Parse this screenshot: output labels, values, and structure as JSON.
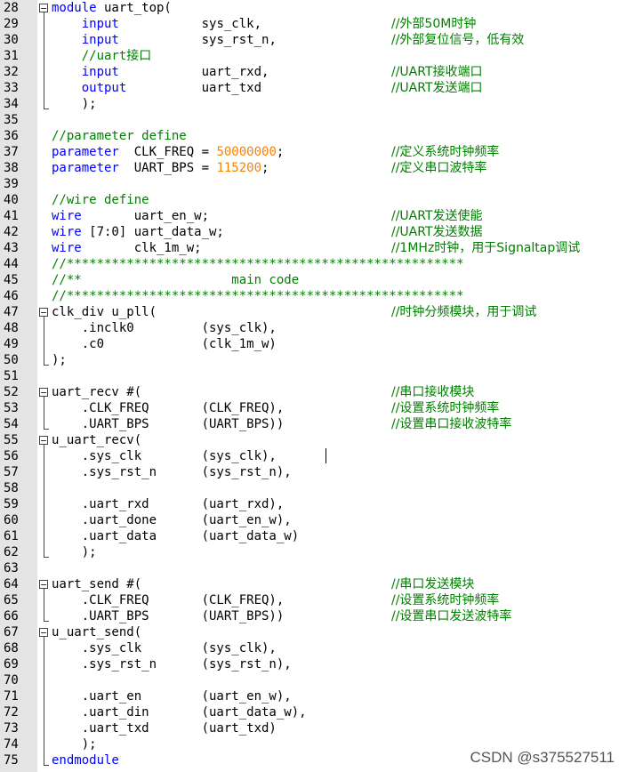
{
  "editor": {
    "lines": [
      {
        "n": "28",
        "parts": [
          {
            "t": "module",
            "c": "kw"
          },
          {
            "t": " uart_top("
          }
        ]
      },
      {
        "n": "29",
        "parts": [
          {
            "t": "    "
          },
          {
            "t": "input",
            "c": "kw"
          },
          {
            "t": "           sys_clk,"
          }
        ],
        "comment": "//外部50M时钟"
      },
      {
        "n": "30",
        "parts": [
          {
            "t": "    "
          },
          {
            "t": "input",
            "c": "kw"
          },
          {
            "t": "           sys_rst_n,"
          }
        ],
        "comment": "//外部复位信号，低有效"
      },
      {
        "n": "31",
        "parts": [
          {
            "t": "    "
          },
          {
            "t": "//uart接口",
            "c": "green"
          }
        ]
      },
      {
        "n": "32",
        "parts": [
          {
            "t": "    "
          },
          {
            "t": "input",
            "c": "kw"
          },
          {
            "t": "           uart_rxd,"
          }
        ],
        "comment": "//UART接收端口"
      },
      {
        "n": "33",
        "parts": [
          {
            "t": "    "
          },
          {
            "t": "output",
            "c": "kw"
          },
          {
            "t": "          uart_txd"
          }
        ],
        "comment": "//UART发送端口"
      },
      {
        "n": "34",
        "parts": [
          {
            "t": "    );"
          }
        ]
      },
      {
        "n": "35",
        "parts": []
      },
      {
        "n": "36",
        "parts": [
          {
            "t": "//parameter define",
            "c": "green"
          }
        ]
      },
      {
        "n": "37",
        "parts": [
          {
            "t": "parameter",
            "c": "kw"
          },
          {
            "t": "  CLK_FREQ = "
          },
          {
            "t": "50000000",
            "c": "num"
          },
          {
            "t": ";"
          }
        ],
        "comment": "//定义系统时钟频率"
      },
      {
        "n": "38",
        "parts": [
          {
            "t": "parameter",
            "c": "kw"
          },
          {
            "t": "  UART_BPS = "
          },
          {
            "t": "115200",
            "c": "num"
          },
          {
            "t": ";"
          }
        ],
        "comment": "//定义串口波特率"
      },
      {
        "n": "39",
        "parts": []
      },
      {
        "n": "40",
        "parts": [
          {
            "t": "//wire define",
            "c": "green"
          }
        ]
      },
      {
        "n": "41",
        "parts": [
          {
            "t": "wire",
            "c": "kw"
          },
          {
            "t": "       uart_en_w;"
          }
        ],
        "comment": "//UART发送使能"
      },
      {
        "n": "42",
        "parts": [
          {
            "t": "wire",
            "c": "kw"
          },
          {
            "t": " [7:0] uart_data_w;"
          }
        ],
        "comment": "//UART发送数据"
      },
      {
        "n": "43",
        "parts": [
          {
            "t": "wire",
            "c": "kw"
          },
          {
            "t": "       clk_1m_w;"
          }
        ],
        "comment": "//1MHz时钟，用于Signaltap调试"
      },
      {
        "n": "44",
        "parts": [
          {
            "t": "//*****************************************************",
            "c": "green"
          }
        ]
      },
      {
        "n": "45",
        "parts": [
          {
            "t": "//**                    main code",
            "c": "green"
          }
        ]
      },
      {
        "n": "46",
        "parts": [
          {
            "t": "//*****************************************************",
            "c": "green"
          }
        ]
      },
      {
        "n": "47",
        "parts": [
          {
            "t": "clk_div u_pll("
          }
        ],
        "comment": "//时钟分频模块，用于调试"
      },
      {
        "n": "48",
        "parts": [
          {
            "t": "    .inclk0         (sys_clk),"
          }
        ]
      },
      {
        "n": "49",
        "parts": [
          {
            "t": "    .c0             (clk_1m_w)"
          }
        ]
      },
      {
        "n": "50",
        "parts": [
          {
            "t": ");"
          }
        ]
      },
      {
        "n": "51",
        "parts": []
      },
      {
        "n": "52",
        "parts": [
          {
            "t": "uart_recv #("
          }
        ],
        "comment": "//串口接收模块"
      },
      {
        "n": "53",
        "parts": [
          {
            "t": "    .CLK_FREQ       (CLK_FREQ),"
          }
        ],
        "comment": "//设置系统时钟频率"
      },
      {
        "n": "54",
        "parts": [
          {
            "t": "    .UART_BPS       (UART_BPS))"
          }
        ],
        "comment": "//设置串口接收波特率"
      },
      {
        "n": "55",
        "parts": [
          {
            "t": "u_uart_recv("
          }
        ]
      },
      {
        "n": "56",
        "parts": [
          {
            "t": "    .sys_clk        (sys_clk),"
          }
        ]
      },
      {
        "n": "57",
        "parts": [
          {
            "t": "    .sys_rst_n      (sys_rst_n),"
          }
        ]
      },
      {
        "n": "58",
        "parts": []
      },
      {
        "n": "59",
        "parts": [
          {
            "t": "    .uart_rxd       (uart_rxd),"
          }
        ]
      },
      {
        "n": "60",
        "parts": [
          {
            "t": "    .uart_done      (uart_en_w),"
          }
        ]
      },
      {
        "n": "61",
        "parts": [
          {
            "t": "    .uart_data      (uart_data_w)"
          }
        ]
      },
      {
        "n": "62",
        "parts": [
          {
            "t": "    );"
          }
        ]
      },
      {
        "n": "63",
        "parts": []
      },
      {
        "n": "64",
        "parts": [
          {
            "t": "uart_send #("
          }
        ],
        "comment": "//串口发送模块"
      },
      {
        "n": "65",
        "parts": [
          {
            "t": "    .CLK_FREQ       (CLK_FREQ),"
          }
        ],
        "comment": "//设置系统时钟频率"
      },
      {
        "n": "66",
        "parts": [
          {
            "t": "    .UART_BPS       (UART_BPS))"
          }
        ],
        "comment": "//设置串口发送波特率"
      },
      {
        "n": "67",
        "parts": [
          {
            "t": "u_uart_send("
          }
        ]
      },
      {
        "n": "68",
        "parts": [
          {
            "t": "    .sys_clk        (sys_clk),"
          }
        ]
      },
      {
        "n": "69",
        "parts": [
          {
            "t": "    .sys_rst_n      (sys_rst_n),"
          }
        ]
      },
      {
        "n": "70",
        "parts": []
      },
      {
        "n": "71",
        "parts": [
          {
            "t": "    .uart_en        (uart_en_w),"
          }
        ]
      },
      {
        "n": "72",
        "parts": [
          {
            "t": "    .uart_din       (uart_data_w),"
          }
        ]
      },
      {
        "n": "73",
        "parts": [
          {
            "t": "    .uart_txd       (uart_txd)"
          }
        ]
      },
      {
        "n": "74",
        "parts": [
          {
            "t": "    );"
          }
        ]
      },
      {
        "n": "75",
        "parts": [
          {
            "t": "endmodule",
            "c": "kw"
          }
        ]
      }
    ],
    "folds": [
      {
        "start": "28",
        "end": "34"
      },
      {
        "start": "47",
        "end": "50"
      },
      {
        "start": "52",
        "end": "54"
      },
      {
        "start": "55",
        "end": "62"
      },
      {
        "start": "64",
        "end": "66"
      },
      {
        "start": "67",
        "end": "75"
      }
    ]
  },
  "watermark": "CSDN @s375527511",
  "colors": {
    "keyword": "#0000ff",
    "comment": "#008000",
    "number": "#ff8000",
    "gutter": "#e4e4e4"
  }
}
